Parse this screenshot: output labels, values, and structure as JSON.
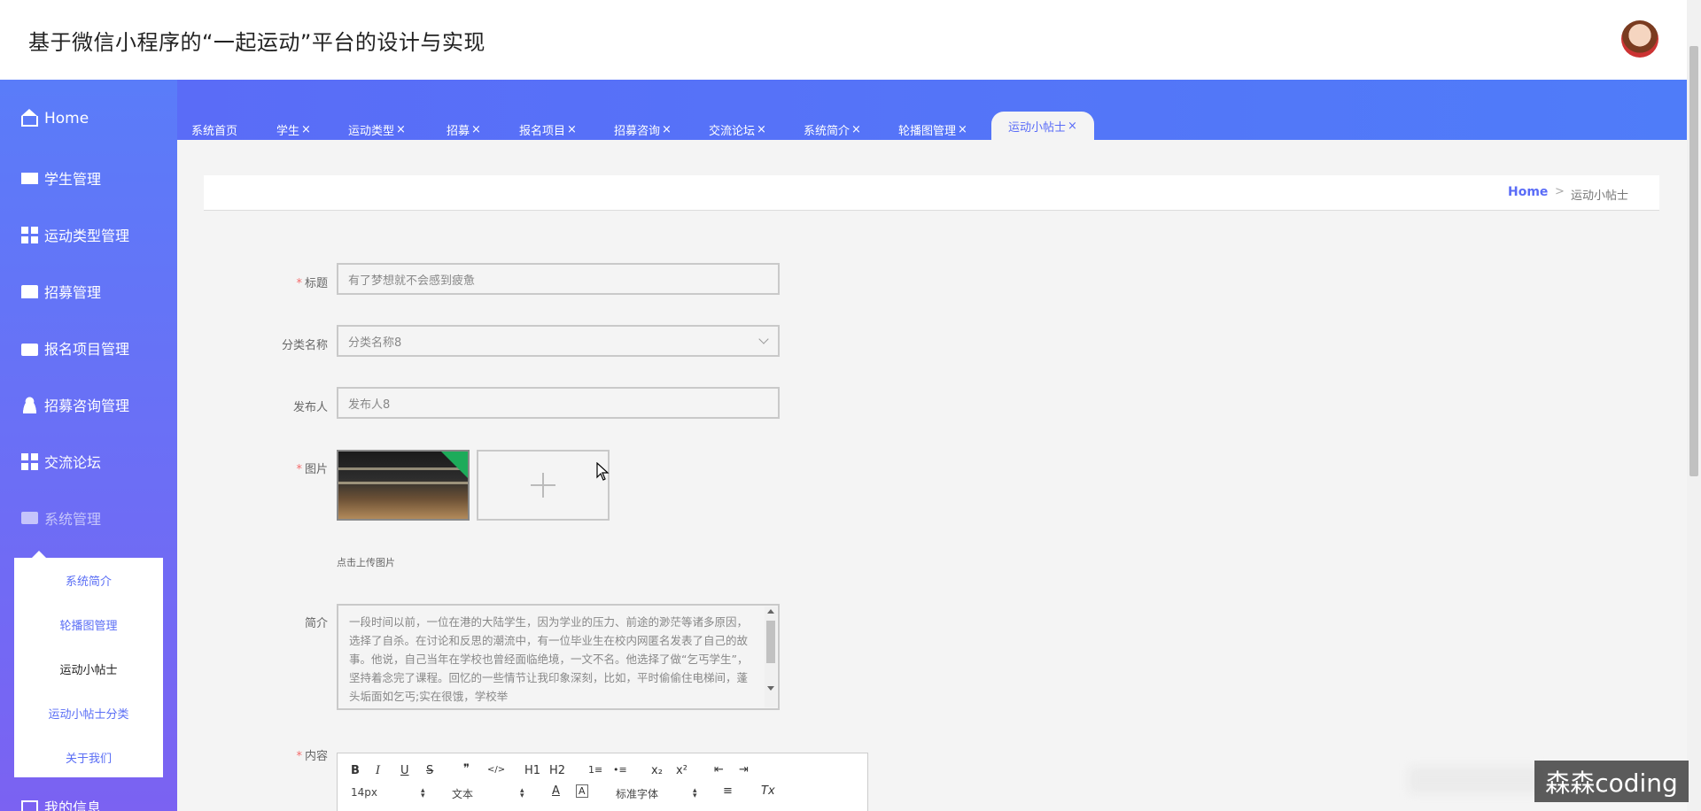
{
  "header": {
    "title": "基于微信小程序的“一起运动”平台的设计与实现"
  },
  "sidebar": {
    "home": "Home",
    "items": [
      {
        "label": "学生管理"
      },
      {
        "label": "运动类型管理"
      },
      {
        "label": "招募管理"
      },
      {
        "label": "报名项目管理"
      },
      {
        "label": "招募咨询管理"
      },
      {
        "label": "交流论坛"
      },
      {
        "label": "系统管理"
      },
      {
        "label": "我的信息"
      }
    ],
    "submenu": [
      {
        "label": "系统简介"
      },
      {
        "label": "轮播图管理"
      },
      {
        "label": "运动小帖士"
      },
      {
        "label": "运动小帖士分类"
      },
      {
        "label": "关于我们"
      }
    ]
  },
  "tabs": [
    {
      "label": "系统首页",
      "close": ""
    },
    {
      "label": "学生",
      "close": "×"
    },
    {
      "label": "运动类型",
      "close": "×"
    },
    {
      "label": "招募",
      "close": "×"
    },
    {
      "label": "报名项目",
      "close": "×"
    },
    {
      "label": "招募咨询",
      "close": "×"
    },
    {
      "label": "交流论坛",
      "close": "×"
    },
    {
      "label": "系统简介",
      "close": "×"
    },
    {
      "label": "轮播图管理",
      "close": "×"
    },
    {
      "label": "运动小帖士",
      "close": "×"
    }
  ],
  "breadcrumb": {
    "home": "Home",
    "separator": ">",
    "current": "运动小帖士"
  },
  "form": {
    "required_mark": "*",
    "title_label": "标题",
    "title_value": "有了梦想就不会感到疲惫",
    "category_label": "分类名称",
    "category_value": "分类名称8",
    "publisher_label": "发布人",
    "publisher_value": "发布人8",
    "image_label": "图片",
    "upload_hint": "点击上传图片",
    "intro_label": "简介",
    "intro_value": "一段时间以前，一位在港的大陆学生，因为学业的压力、前途的渺茫等诸多原因，选择了自杀。在讨论和反思的潮流中，有一位毕业生在校内网匿名发表了自己的故事。他说，自己当年在学校也曾经面临绝境，一文不名。他选择了做“乞丐学生”，坚持着念完了课程。回忆的一些情节让我印象深刻，比如，平时偷偷住电梯间，蓬头垢面如乞丐;实在很饿，学校举",
    "content_label": "内容"
  },
  "editor": {
    "font_size": "14px",
    "block_type": "文本",
    "font_family": "标准字体",
    "buttons": {
      "bold": "B",
      "italic": "I",
      "underline": "U",
      "strike": "S",
      "quote": "❞",
      "code": "</>",
      "h1": "H1",
      "h2": "H2",
      "ol": "1≡",
      "ul": "•≡",
      "sub": "x₂",
      "sup": "x²",
      "outdent": "⇤",
      "indent": "⇥",
      "color": "A",
      "bg": "A",
      "align": "≡",
      "clear": "Tx"
    }
  },
  "watermark": "森森coding",
  "colors": {
    "accent": "#5a6cf7",
    "sidebar_top": "#5a7cf9",
    "sidebar_bottom": "#7b62f2",
    "required": "#f56c6c"
  }
}
